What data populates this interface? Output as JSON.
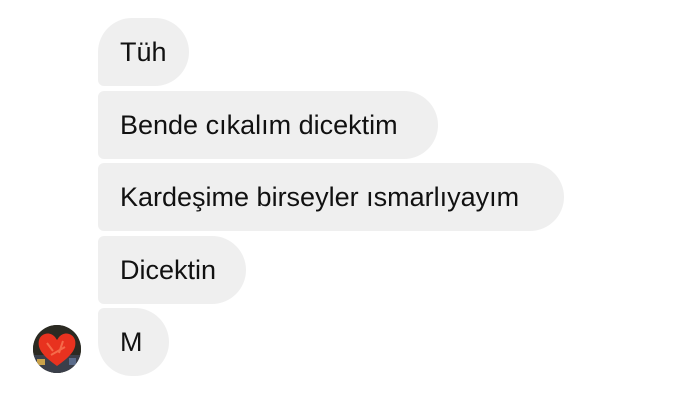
{
  "conversation": {
    "messages": [
      {
        "text": "Tüh"
      },
      {
        "text": "Bende cıkalım dicektim"
      },
      {
        "text": "Kardeşime birseyler ısmarlıyayım"
      },
      {
        "text": "Dicektin"
      },
      {
        "text": "M"
      }
    ]
  },
  "sender": {
    "avatar_icon": "profile-photo-heart"
  },
  "colors": {
    "bubble_background": "#efefef",
    "text": "#111111",
    "avatar_heart": "#e8321f"
  }
}
